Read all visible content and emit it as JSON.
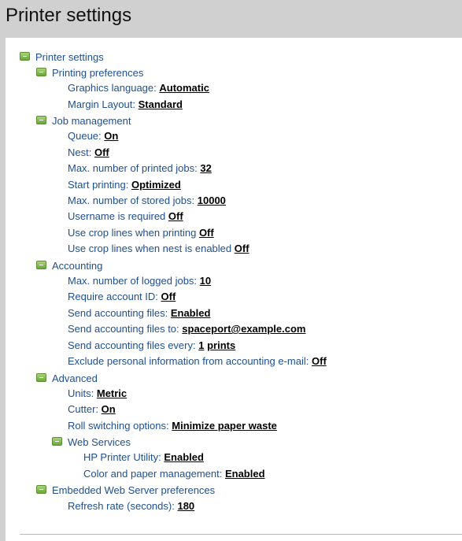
{
  "title": "Printer settings",
  "tree": {
    "root": "Printer settings",
    "printing_preferences": {
      "label": "Printing preferences",
      "graphics_language": {
        "label": "Graphics language:",
        "value": "Automatic"
      },
      "margin_layout": {
        "label": "Margin Layout:",
        "value": "Standard"
      }
    },
    "job_management": {
      "label": "Job management",
      "queue": {
        "label": "Queue:",
        "value": "On"
      },
      "nest": {
        "label": "Nest:",
        "value": "Off"
      },
      "max_printed": {
        "label": "Max. number of printed jobs:",
        "value": "32"
      },
      "start_printing": {
        "label": "Start printing:",
        "value": "Optimized"
      },
      "max_stored": {
        "label": "Max. number of stored jobs:",
        "value": "10000"
      },
      "username_required": {
        "label": "Username is required",
        "value": "Off"
      },
      "crop_printing": {
        "label": "Use crop lines when printing",
        "value": "Off"
      },
      "crop_nest": {
        "label": "Use crop lines when nest is enabled",
        "value": "Off"
      }
    },
    "accounting": {
      "label": "Accounting",
      "max_logged": {
        "label": "Max. number of logged jobs:",
        "value": "10"
      },
      "require_account": {
        "label": "Require account ID:",
        "value": "Off"
      },
      "send_files": {
        "label": "Send accounting files:",
        "value": "Enabled"
      },
      "send_to": {
        "label": "Send accounting files to:",
        "value": "spaceport@example.com"
      },
      "send_every": {
        "label": "Send accounting files every:",
        "value": "1",
        "unit": "prints"
      },
      "exclude_personal": {
        "label": "Exclude personal information from accounting e-mail:",
        "value": "Off"
      }
    },
    "advanced": {
      "label": "Advanced",
      "units": {
        "label": "Units:",
        "value": "Metric"
      },
      "cutter": {
        "label": "Cutter:",
        "value": "On"
      },
      "roll_switching": {
        "label": "Roll switching options:",
        "value": "Minimize paper waste"
      },
      "web_services": {
        "label": "Web Services",
        "hp_utility": {
          "label": "HP Printer Utility:",
          "value": "Enabled"
        },
        "color_paper": {
          "label": "Color and paper management:",
          "value": "Enabled"
        }
      }
    },
    "ews": {
      "label": "Embedded Web Server preferences",
      "refresh_rate": {
        "label": "Refresh rate (seconds):",
        "value": "180"
      }
    }
  }
}
